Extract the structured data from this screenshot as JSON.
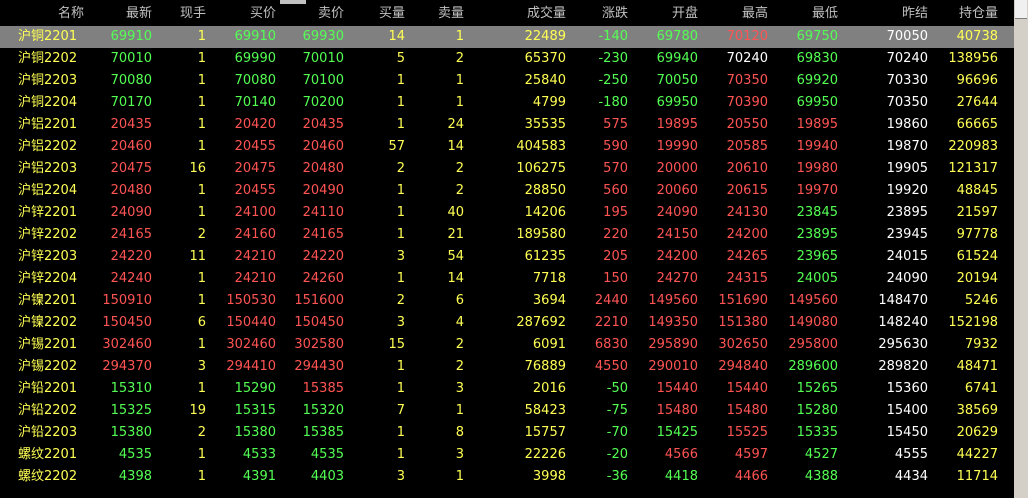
{
  "header": [
    "名称",
    "最新",
    "现手",
    "买价",
    "卖价",
    "买量",
    "卖量",
    "成交量",
    "涨跌",
    "开盘",
    "最高",
    "最低",
    "昨结",
    "持仓量"
  ],
  "colors": {
    "up": "#ff5454",
    "down": "#54ff54",
    "yellow": "#ffff54",
    "neutral": "#ffffff",
    "header": "#c0c0c0",
    "selected_bg": "#808080"
  },
  "rows": [
    {
      "name": "沪铜2201",
      "latest": "69910",
      "cur": "1",
      "bid": "69910",
      "ask": "69930",
      "bidvol": "14",
      "askvol": "1",
      "volume": "22489",
      "change": "-140",
      "open": "69780",
      "high": "70120",
      "low": "69750",
      "prev": "70050",
      "oi": "40738",
      "latest_c": "down",
      "bid_c": "down",
      "ask_c": "down",
      "change_c": "down",
      "open_c": "down",
      "high_c": "up",
      "low_c": "down"
    },
    {
      "name": "沪铜2202",
      "latest": "70010",
      "cur": "1",
      "bid": "69990",
      "ask": "70010",
      "bidvol": "5",
      "askvol": "2",
      "volume": "65370",
      "change": "-230",
      "open": "69940",
      "high": "70240",
      "low": "69830",
      "prev": "70240",
      "oi": "138956",
      "latest_c": "down",
      "bid_c": "down",
      "ask_c": "down",
      "change_c": "down",
      "open_c": "down",
      "high_c": "neutral",
      "low_c": "down"
    },
    {
      "name": "沪铜2203",
      "latest": "70080",
      "cur": "1",
      "bid": "70080",
      "ask": "70100",
      "bidvol": "1",
      "askvol": "1",
      "volume": "25840",
      "change": "-250",
      "open": "70050",
      "high": "70350",
      "low": "69920",
      "prev": "70330",
      "oi": "96696",
      "latest_c": "down",
      "bid_c": "down",
      "ask_c": "down",
      "change_c": "down",
      "open_c": "down",
      "high_c": "up",
      "low_c": "down"
    },
    {
      "name": "沪铜2204",
      "latest": "70170",
      "cur": "1",
      "bid": "70140",
      "ask": "70200",
      "bidvol": "1",
      "askvol": "1",
      "volume": "4799",
      "change": "-180",
      "open": "69950",
      "high": "70390",
      "low": "69950",
      "prev": "70350",
      "oi": "27644",
      "latest_c": "down",
      "bid_c": "down",
      "ask_c": "down",
      "change_c": "down",
      "open_c": "down",
      "high_c": "up",
      "low_c": "down"
    },
    {
      "name": "沪铝2201",
      "latest": "20435",
      "cur": "1",
      "bid": "20420",
      "ask": "20435",
      "bidvol": "1",
      "askvol": "24",
      "volume": "35535",
      "change": "575",
      "open": "19895",
      "high": "20550",
      "low": "19895",
      "prev": "19860",
      "oi": "66665",
      "latest_c": "up",
      "bid_c": "up",
      "ask_c": "up",
      "change_c": "up",
      "open_c": "up",
      "high_c": "up",
      "low_c": "up"
    },
    {
      "name": "沪铝2202",
      "latest": "20460",
      "cur": "1",
      "bid": "20455",
      "ask": "20460",
      "bidvol": "57",
      "askvol": "14",
      "volume": "404583",
      "change": "590",
      "open": "19990",
      "high": "20585",
      "low": "19940",
      "prev": "19870",
      "oi": "220983",
      "latest_c": "up",
      "bid_c": "up",
      "ask_c": "up",
      "change_c": "up",
      "open_c": "up",
      "high_c": "up",
      "low_c": "up"
    },
    {
      "name": "沪铝2203",
      "latest": "20475",
      "cur": "16",
      "bid": "20475",
      "ask": "20480",
      "bidvol": "2",
      "askvol": "2",
      "volume": "106275",
      "change": "570",
      "open": "20000",
      "high": "20610",
      "low": "19980",
      "prev": "19905",
      "oi": "121317",
      "latest_c": "up",
      "bid_c": "up",
      "ask_c": "up",
      "change_c": "up",
      "open_c": "up",
      "high_c": "up",
      "low_c": "up"
    },
    {
      "name": "沪铝2204",
      "latest": "20480",
      "cur": "1",
      "bid": "20455",
      "ask": "20490",
      "bidvol": "1",
      "askvol": "2",
      "volume": "28850",
      "change": "560",
      "open": "20060",
      "high": "20615",
      "low": "19970",
      "prev": "19920",
      "oi": "48845",
      "latest_c": "up",
      "bid_c": "up",
      "ask_c": "up",
      "change_c": "up",
      "open_c": "up",
      "high_c": "up",
      "low_c": "up"
    },
    {
      "name": "沪锌2201",
      "latest": "24090",
      "cur": "1",
      "bid": "24100",
      "ask": "24110",
      "bidvol": "1",
      "askvol": "40",
      "volume": "14206",
      "change": "195",
      "open": "24090",
      "high": "24130",
      "low": "23845",
      "prev": "23895",
      "oi": "21597",
      "latest_c": "up",
      "bid_c": "up",
      "ask_c": "up",
      "change_c": "up",
      "open_c": "up",
      "high_c": "up",
      "low_c": "down"
    },
    {
      "name": "沪锌2202",
      "latest": "24165",
      "cur": "2",
      "bid": "24160",
      "ask": "24165",
      "bidvol": "1",
      "askvol": "21",
      "volume": "189580",
      "change": "220",
      "open": "24150",
      "high": "24200",
      "low": "23895",
      "prev": "23945",
      "oi": "97778",
      "latest_c": "up",
      "bid_c": "up",
      "ask_c": "up",
      "change_c": "up",
      "open_c": "up",
      "high_c": "up",
      "low_c": "down"
    },
    {
      "name": "沪锌2203",
      "latest": "24220",
      "cur": "11",
      "bid": "24210",
      "ask": "24220",
      "bidvol": "3",
      "askvol": "54",
      "volume": "61235",
      "change": "205",
      "open": "24200",
      "high": "24265",
      "low": "23965",
      "prev": "24015",
      "oi": "61524",
      "latest_c": "up",
      "bid_c": "up",
      "ask_c": "up",
      "change_c": "up",
      "open_c": "up",
      "high_c": "up",
      "low_c": "down"
    },
    {
      "name": "沪锌2204",
      "latest": "24240",
      "cur": "1",
      "bid": "24210",
      "ask": "24260",
      "bidvol": "1",
      "askvol": "14",
      "volume": "7718",
      "change": "150",
      "open": "24270",
      "high": "24315",
      "low": "24005",
      "prev": "24090",
      "oi": "20194",
      "latest_c": "up",
      "bid_c": "up",
      "ask_c": "up",
      "change_c": "up",
      "open_c": "up",
      "high_c": "up",
      "low_c": "down"
    },
    {
      "name": "沪镍2201",
      "latest": "150910",
      "cur": "1",
      "bid": "150530",
      "ask": "151600",
      "bidvol": "2",
      "askvol": "6",
      "volume": "3694",
      "change": "2440",
      "open": "149560",
      "high": "151690",
      "low": "149560",
      "prev": "148470",
      "oi": "5246",
      "latest_c": "up",
      "bid_c": "up",
      "ask_c": "up",
      "change_c": "up",
      "open_c": "up",
      "high_c": "up",
      "low_c": "up"
    },
    {
      "name": "沪镍2202",
      "latest": "150450",
      "cur": "6",
      "bid": "150440",
      "ask": "150450",
      "bidvol": "3",
      "askvol": "4",
      "volume": "287692",
      "change": "2210",
      "open": "149350",
      "high": "151380",
      "low": "149080",
      "prev": "148240",
      "oi": "152198",
      "latest_c": "up",
      "bid_c": "up",
      "ask_c": "up",
      "change_c": "up",
      "open_c": "up",
      "high_c": "up",
      "low_c": "up"
    },
    {
      "name": "沪锡2201",
      "latest": "302460",
      "cur": "1",
      "bid": "302460",
      "ask": "302580",
      "bidvol": "15",
      "askvol": "2",
      "volume": "6091",
      "change": "6830",
      "open": "295890",
      "high": "302650",
      "low": "295800",
      "prev": "295630",
      "oi": "7932",
      "latest_c": "up",
      "bid_c": "up",
      "ask_c": "up",
      "change_c": "up",
      "open_c": "up",
      "high_c": "up",
      "low_c": "up"
    },
    {
      "name": "沪锡2202",
      "latest": "294370",
      "cur": "3",
      "bid": "294410",
      "ask": "294430",
      "bidvol": "1",
      "askvol": "2",
      "volume": "76889",
      "change": "4550",
      "open": "290010",
      "high": "294840",
      "low": "289600",
      "prev": "289820",
      "oi": "48471",
      "latest_c": "up",
      "bid_c": "up",
      "ask_c": "up",
      "change_c": "up",
      "open_c": "up",
      "high_c": "up",
      "low_c": "down"
    },
    {
      "name": "沪铅2201",
      "latest": "15310",
      "cur": "1",
      "bid": "15290",
      "ask": "15385",
      "bidvol": "1",
      "askvol": "3",
      "volume": "2016",
      "change": "-50",
      "open": "15440",
      "high": "15440",
      "low": "15265",
      "prev": "15360",
      "oi": "6741",
      "latest_c": "down",
      "bid_c": "down",
      "ask_c": "up",
      "change_c": "down",
      "open_c": "up",
      "high_c": "up",
      "low_c": "down"
    },
    {
      "name": "沪铅2202",
      "latest": "15325",
      "cur": "19",
      "bid": "15315",
      "ask": "15320",
      "bidvol": "7",
      "askvol": "1",
      "volume": "58423",
      "change": "-75",
      "open": "15480",
      "high": "15480",
      "low": "15280",
      "prev": "15400",
      "oi": "38569",
      "latest_c": "down",
      "bid_c": "down",
      "ask_c": "down",
      "change_c": "down",
      "open_c": "up",
      "high_c": "up",
      "low_c": "down"
    },
    {
      "name": "沪铅2203",
      "latest": "15380",
      "cur": "2",
      "bid": "15380",
      "ask": "15385",
      "bidvol": "1",
      "askvol": "8",
      "volume": "15757",
      "change": "-70",
      "open": "15425",
      "high": "15525",
      "low": "15335",
      "prev": "15450",
      "oi": "20629",
      "latest_c": "down",
      "bid_c": "down",
      "ask_c": "down",
      "change_c": "down",
      "open_c": "down",
      "high_c": "up",
      "low_c": "down"
    },
    {
      "name": "螺纹2201",
      "latest": "4535",
      "cur": "1",
      "bid": "4533",
      "ask": "4535",
      "bidvol": "1",
      "askvol": "3",
      "volume": "22226",
      "change": "-20",
      "open": "4566",
      "high": "4597",
      "low": "4527",
      "prev": "4555",
      "oi": "44227",
      "latest_c": "down",
      "bid_c": "down",
      "ask_c": "down",
      "change_c": "down",
      "open_c": "up",
      "high_c": "up",
      "low_c": "down"
    },
    {
      "name": "螺纹2202",
      "latest": "4398",
      "cur": "1",
      "bid": "4391",
      "ask": "4403",
      "bidvol": "3",
      "askvol": "1",
      "volume": "3998",
      "change": "-36",
      "open": "4418",
      "high": "4466",
      "low": "4388",
      "prev": "4434",
      "oi": "11714",
      "latest_c": "down",
      "bid_c": "down",
      "ask_c": "down",
      "change_c": "down",
      "open_c": "down",
      "high_c": "up",
      "low_c": "down"
    }
  ]
}
